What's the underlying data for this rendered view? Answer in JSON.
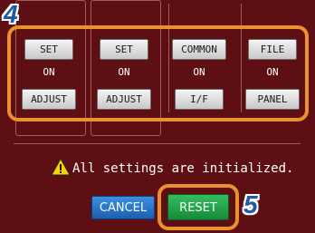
{
  "callouts": {
    "step4": "4",
    "step5": "5"
  },
  "columns": [
    {
      "top_button": "SET",
      "status": "ON",
      "bottom_button": "ADJUST"
    },
    {
      "top_button": "SET",
      "status": "ON",
      "bottom_button": "ADJUST"
    },
    {
      "top_button": "COMMON",
      "status": "ON",
      "bottom_button": "I/F"
    },
    {
      "top_button": "FILE",
      "status": "ON",
      "bottom_button": "PANEL"
    }
  ],
  "message": {
    "icon": "warning-icon",
    "text": "All settings are initialized."
  },
  "actions": {
    "cancel_label": "CANCEL",
    "reset_label": "RESET"
  },
  "colors": {
    "background": "#5e0f14",
    "highlight": "#e8912e",
    "callout": "#1e5aa8",
    "cancel": "#1f73c9",
    "reset": "#22a04b"
  }
}
